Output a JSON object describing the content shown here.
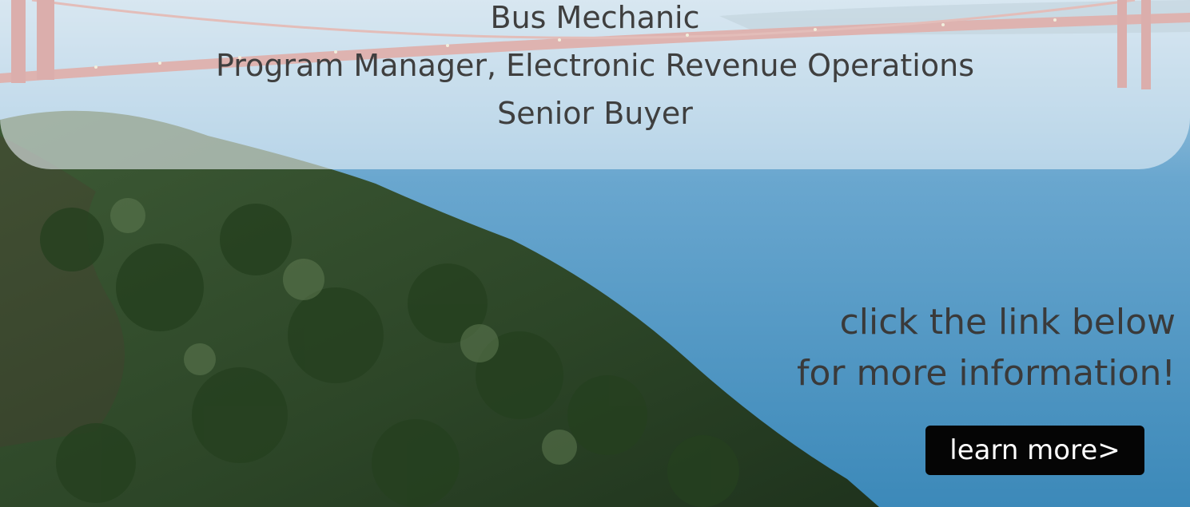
{
  "job_list": [
    "Bus Mechanic",
    "Program Manager, Electronic Revenue Operations",
    "Senior Buyer"
  ],
  "cta": {
    "line1": "click the link below",
    "line2": "for more information!",
    "button_label": "learn more>"
  },
  "colors": {
    "panel": "#eef4f9",
    "button": "#050505",
    "button_text": "#ffffff",
    "bridge": "#c8584a",
    "water": "#3f8dbd",
    "forest": "#2f4a2b"
  },
  "icons": {
    "background": "golden-gate-bridge-photo"
  }
}
